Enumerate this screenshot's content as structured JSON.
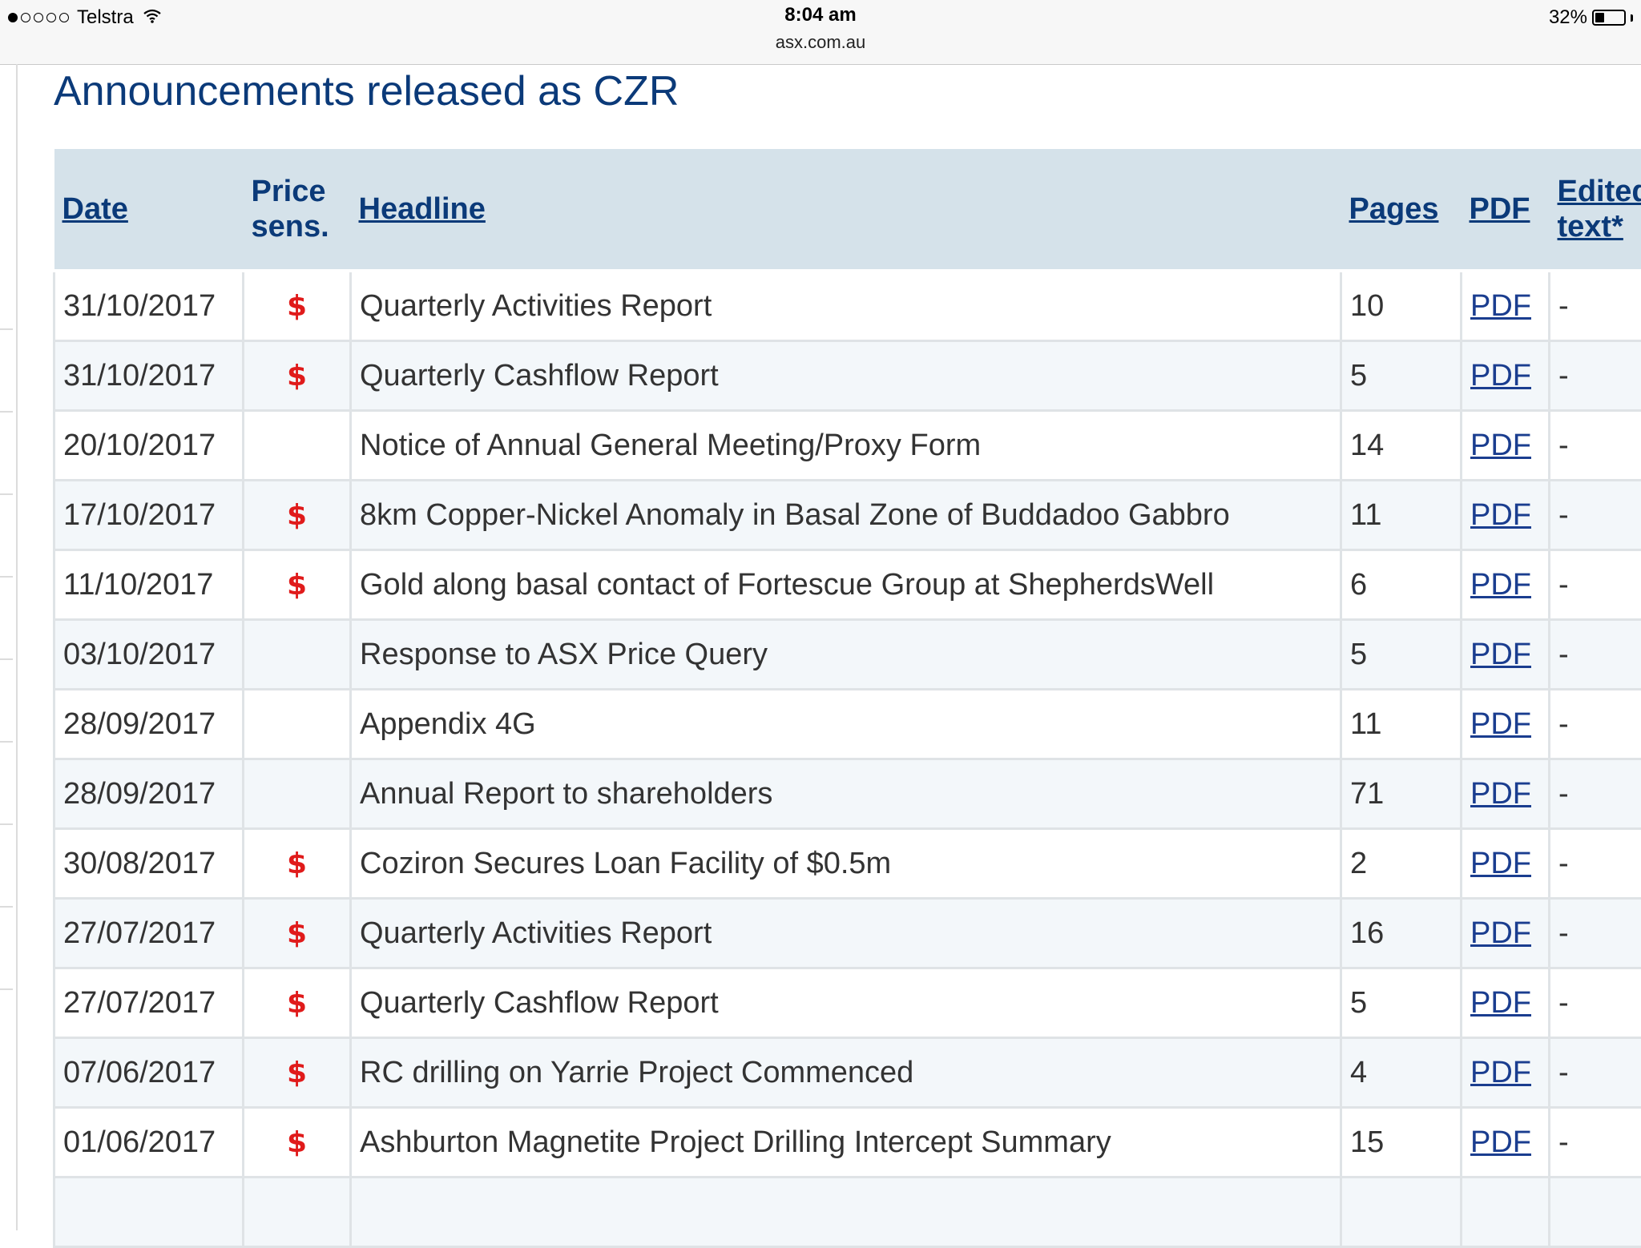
{
  "status_bar": {
    "carrier": "Telstra",
    "signal_bars": 1,
    "time": "8:04 am",
    "url": "asx.com.au",
    "battery": "32%",
    "battery_level": 0.32
  },
  "page": {
    "title": "Announcements released as CZR"
  },
  "table": {
    "headers": {
      "date": "Date",
      "price_sens_line1": "Price",
      "price_sens_line2": "sens.",
      "headline": "Headline",
      "pages": "Pages",
      "pdf": "PDF",
      "edited_line1": "Edited",
      "edited_line2": "text*"
    },
    "price_sensitive_symbol": "$",
    "rows": [
      {
        "date": "31/10/2017",
        "price_sensitive": true,
        "headline": "Quarterly Activities Report",
        "pages": "10",
        "pdf": "PDF",
        "edited": "-"
      },
      {
        "date": "31/10/2017",
        "price_sensitive": true,
        "headline": "Quarterly Cashflow Report",
        "pages": "5",
        "pdf": "PDF",
        "edited": "-"
      },
      {
        "date": "20/10/2017",
        "price_sensitive": false,
        "headline": "Notice of Annual General Meeting/Proxy Form",
        "pages": "14",
        "pdf": "PDF",
        "edited": "-"
      },
      {
        "date": "17/10/2017",
        "price_sensitive": true,
        "headline": "8km Copper-Nickel Anomaly in Basal Zone of Buddadoo Gabbro",
        "pages": "11",
        "pdf": "PDF",
        "edited": "-"
      },
      {
        "date": "11/10/2017",
        "price_sensitive": true,
        "headline": "Gold along basal contact of Fortescue Group at ShepherdsWell",
        "pages": "6",
        "pdf": "PDF",
        "edited": "-"
      },
      {
        "date": "03/10/2017",
        "price_sensitive": false,
        "headline": "Response to ASX Price Query",
        "pages": "5",
        "pdf": "PDF",
        "edited": "-"
      },
      {
        "date": "28/09/2017",
        "price_sensitive": false,
        "headline": "Appendix 4G",
        "pages": "11",
        "pdf": "PDF",
        "edited": "-"
      },
      {
        "date": "28/09/2017",
        "price_sensitive": false,
        "headline": "Annual Report to shareholders",
        "pages": "71",
        "pdf": "PDF",
        "edited": "-"
      },
      {
        "date": "30/08/2017",
        "price_sensitive": true,
        "headline": "Coziron Secures Loan Facility of $0.5m",
        "pages": "2",
        "pdf": "PDF",
        "edited": "-"
      },
      {
        "date": "27/07/2017",
        "price_sensitive": true,
        "headline": "Quarterly Activities Report",
        "pages": "16",
        "pdf": "PDF",
        "edited": "-"
      },
      {
        "date": "27/07/2017",
        "price_sensitive": true,
        "headline": "Quarterly Cashflow Report",
        "pages": "5",
        "pdf": "PDF",
        "edited": "-"
      },
      {
        "date": "07/06/2017",
        "price_sensitive": true,
        "headline": "RC drilling on Yarrie Project Commenced",
        "pages": "4",
        "pdf": "PDF",
        "edited": "-"
      },
      {
        "date": "01/06/2017",
        "price_sensitive": true,
        "headline": "Ashburton Magnetite Project Drilling Intercept Summary",
        "pages": "15",
        "pdf": "PDF",
        "edited": "-"
      },
      {
        "date": "",
        "price_sensitive": false,
        "headline": "",
        "pages": "",
        "pdf": "",
        "edited": ""
      }
    ]
  },
  "colors": {
    "title_blue": "#0b3a79",
    "header_bg": "#d5e2ea",
    "price_sensitive_red": "#e01b1b",
    "link_blue": "#1a3d8f"
  }
}
